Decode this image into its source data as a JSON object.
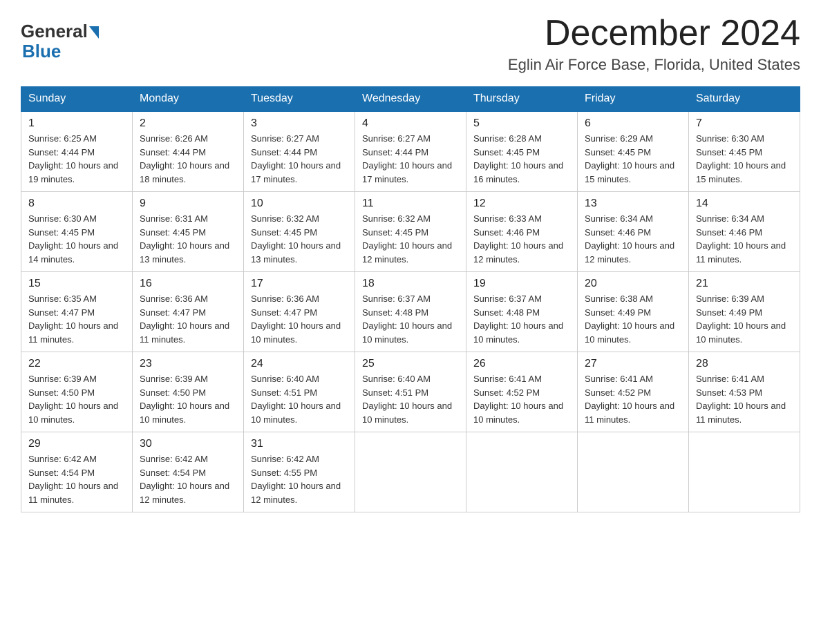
{
  "header": {
    "logo_general": "General",
    "logo_blue": "Blue",
    "month_title": "December 2024",
    "location": "Eglin Air Force Base, Florida, United States"
  },
  "weekdays": [
    "Sunday",
    "Monday",
    "Tuesday",
    "Wednesday",
    "Thursday",
    "Friday",
    "Saturday"
  ],
  "weeks": [
    [
      {
        "day": "1",
        "sunrise": "6:25 AM",
        "sunset": "4:44 PM",
        "daylight": "10 hours and 19 minutes."
      },
      {
        "day": "2",
        "sunrise": "6:26 AM",
        "sunset": "4:44 PM",
        "daylight": "10 hours and 18 minutes."
      },
      {
        "day": "3",
        "sunrise": "6:27 AM",
        "sunset": "4:44 PM",
        "daylight": "10 hours and 17 minutes."
      },
      {
        "day": "4",
        "sunrise": "6:27 AM",
        "sunset": "4:44 PM",
        "daylight": "10 hours and 17 minutes."
      },
      {
        "day": "5",
        "sunrise": "6:28 AM",
        "sunset": "4:45 PM",
        "daylight": "10 hours and 16 minutes."
      },
      {
        "day": "6",
        "sunrise": "6:29 AM",
        "sunset": "4:45 PM",
        "daylight": "10 hours and 15 minutes."
      },
      {
        "day": "7",
        "sunrise": "6:30 AM",
        "sunset": "4:45 PM",
        "daylight": "10 hours and 15 minutes."
      }
    ],
    [
      {
        "day": "8",
        "sunrise": "6:30 AM",
        "sunset": "4:45 PM",
        "daylight": "10 hours and 14 minutes."
      },
      {
        "day": "9",
        "sunrise": "6:31 AM",
        "sunset": "4:45 PM",
        "daylight": "10 hours and 13 minutes."
      },
      {
        "day": "10",
        "sunrise": "6:32 AM",
        "sunset": "4:45 PM",
        "daylight": "10 hours and 13 minutes."
      },
      {
        "day": "11",
        "sunrise": "6:32 AM",
        "sunset": "4:45 PM",
        "daylight": "10 hours and 12 minutes."
      },
      {
        "day": "12",
        "sunrise": "6:33 AM",
        "sunset": "4:46 PM",
        "daylight": "10 hours and 12 minutes."
      },
      {
        "day": "13",
        "sunrise": "6:34 AM",
        "sunset": "4:46 PM",
        "daylight": "10 hours and 12 minutes."
      },
      {
        "day": "14",
        "sunrise": "6:34 AM",
        "sunset": "4:46 PM",
        "daylight": "10 hours and 11 minutes."
      }
    ],
    [
      {
        "day": "15",
        "sunrise": "6:35 AM",
        "sunset": "4:47 PM",
        "daylight": "10 hours and 11 minutes."
      },
      {
        "day": "16",
        "sunrise": "6:36 AM",
        "sunset": "4:47 PM",
        "daylight": "10 hours and 11 minutes."
      },
      {
        "day": "17",
        "sunrise": "6:36 AM",
        "sunset": "4:47 PM",
        "daylight": "10 hours and 10 minutes."
      },
      {
        "day": "18",
        "sunrise": "6:37 AM",
        "sunset": "4:48 PM",
        "daylight": "10 hours and 10 minutes."
      },
      {
        "day": "19",
        "sunrise": "6:37 AM",
        "sunset": "4:48 PM",
        "daylight": "10 hours and 10 minutes."
      },
      {
        "day": "20",
        "sunrise": "6:38 AM",
        "sunset": "4:49 PM",
        "daylight": "10 hours and 10 minutes."
      },
      {
        "day": "21",
        "sunrise": "6:39 AM",
        "sunset": "4:49 PM",
        "daylight": "10 hours and 10 minutes."
      }
    ],
    [
      {
        "day": "22",
        "sunrise": "6:39 AM",
        "sunset": "4:50 PM",
        "daylight": "10 hours and 10 minutes."
      },
      {
        "day": "23",
        "sunrise": "6:39 AM",
        "sunset": "4:50 PM",
        "daylight": "10 hours and 10 minutes."
      },
      {
        "day": "24",
        "sunrise": "6:40 AM",
        "sunset": "4:51 PM",
        "daylight": "10 hours and 10 minutes."
      },
      {
        "day": "25",
        "sunrise": "6:40 AM",
        "sunset": "4:51 PM",
        "daylight": "10 hours and 10 minutes."
      },
      {
        "day": "26",
        "sunrise": "6:41 AM",
        "sunset": "4:52 PM",
        "daylight": "10 hours and 10 minutes."
      },
      {
        "day": "27",
        "sunrise": "6:41 AM",
        "sunset": "4:52 PM",
        "daylight": "10 hours and 11 minutes."
      },
      {
        "day": "28",
        "sunrise": "6:41 AM",
        "sunset": "4:53 PM",
        "daylight": "10 hours and 11 minutes."
      }
    ],
    [
      {
        "day": "29",
        "sunrise": "6:42 AM",
        "sunset": "4:54 PM",
        "daylight": "10 hours and 11 minutes."
      },
      {
        "day": "30",
        "sunrise": "6:42 AM",
        "sunset": "4:54 PM",
        "daylight": "10 hours and 12 minutes."
      },
      {
        "day": "31",
        "sunrise": "6:42 AM",
        "sunset": "4:55 PM",
        "daylight": "10 hours and 12 minutes."
      },
      null,
      null,
      null,
      null
    ]
  ]
}
